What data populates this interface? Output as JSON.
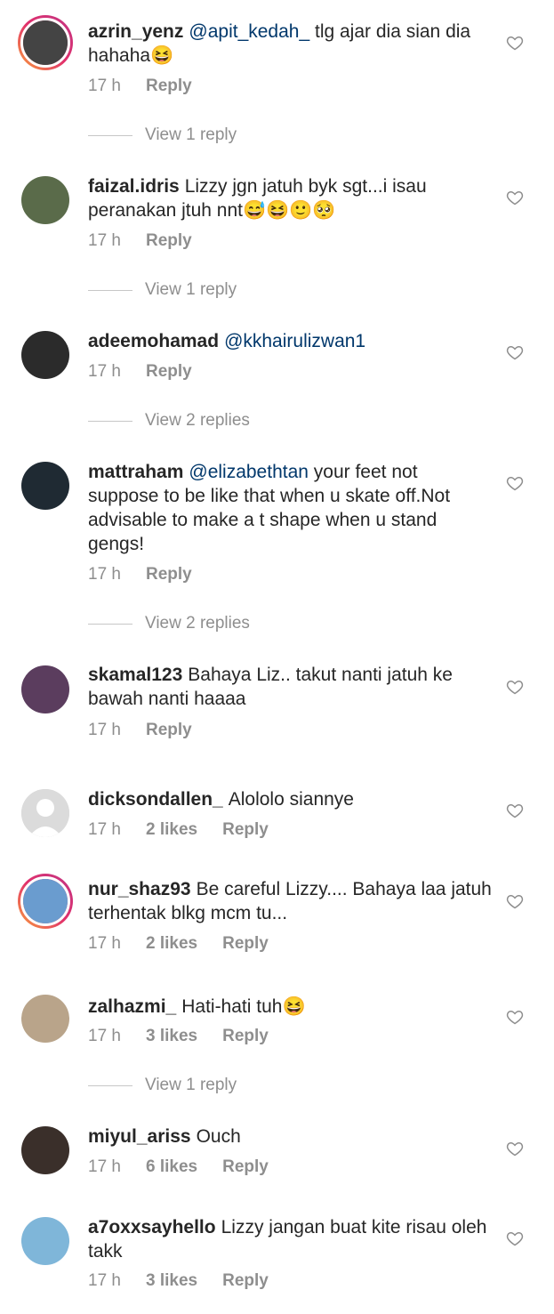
{
  "comments": [
    {
      "user": "azrin_yenz",
      "mention": "@apit_kedah_",
      "text": " tlg ajar dia sian dia hahaha",
      "emoji": "😆",
      "time": "17 h",
      "likes": "",
      "reply": "Reply",
      "view_replies": "View 1 reply",
      "avatar_color": "#444444",
      "ring": true
    },
    {
      "user": "faizal.idris",
      "mention": "",
      "text": "Lizzy jgn jatuh byk sgt...i isau peranakan jtuh nnt",
      "emoji": "😅😆🙂🥺",
      "time": "17 h",
      "likes": "",
      "reply": "Reply",
      "view_replies": "View 1 reply",
      "avatar_color": "#5a6b4a",
      "ring": false
    },
    {
      "user": "adeemohamad",
      "mention": "@kkhairulizwan1",
      "text": "",
      "emoji": "",
      "time": "17 h",
      "likes": "",
      "reply": "Reply",
      "view_replies": "View 2 replies",
      "avatar_color": "#2b2b2b",
      "ring": false
    },
    {
      "user": "mattraham",
      "mention": "@elizabethtan",
      "text": " your feet not suppose to be like that when u skate off.Not advisable to make a t shape when u stand gengs!",
      "emoji": "",
      "time": "17 h",
      "likes": "",
      "reply": "Reply",
      "view_replies": "View 2 replies",
      "avatar_color": "#1f2a33",
      "ring": false
    },
    {
      "user": "skamal123",
      "mention": "",
      "text": "Bahaya Liz.. takut nanti jatuh ke bawah nanti haaaa",
      "emoji": "",
      "time": "17 h",
      "likes": "",
      "reply": "Reply",
      "view_replies": "",
      "avatar_color": "#5b3d5e",
      "ring": false
    },
    {
      "user": "dicksondallen_",
      "mention": "",
      "text": "Alololo siannye",
      "emoji": "",
      "time": "17 h",
      "likes": "2 likes",
      "reply": "Reply",
      "view_replies": "",
      "avatar_color": "#d8d8d8",
      "ring": false
    },
    {
      "user": "nur_shaz93",
      "mention": "",
      "text": "Be careful Lizzy.... Bahaya laa jatuh terhentak  blkg mcm tu...",
      "emoji": "",
      "time": "17 h",
      "likes": "2 likes",
      "reply": "Reply",
      "view_replies": "",
      "avatar_color": "#6a9ccf",
      "ring": true
    },
    {
      "user": "zalhazmi_",
      "mention": "",
      "text": "Hati-hati tuh",
      "emoji": "😆",
      "time": "17 h",
      "likes": "3 likes",
      "reply": "Reply",
      "view_replies": "View 1 reply",
      "avatar_color": "#b9a48a",
      "ring": false
    },
    {
      "user": "miyul_ariss",
      "mention": "",
      "text": "Ouch",
      "emoji": "",
      "time": "17 h",
      "likes": "6 likes",
      "reply": "Reply",
      "view_replies": "",
      "avatar_color": "#3a2f2a",
      "ring": false
    },
    {
      "user": "a7oxxsayhello",
      "mention": "",
      "text": "Lizzy jangan buat kite risau oleh takk",
      "emoji": "",
      "time": "17 h",
      "likes": "3 likes",
      "reply": "Reply",
      "view_replies": "",
      "avatar_color": "#7fb6d9",
      "ring": false
    }
  ]
}
